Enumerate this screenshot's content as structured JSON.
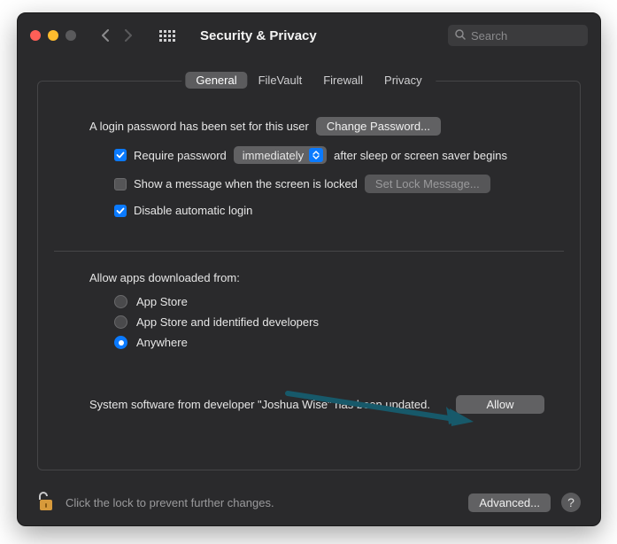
{
  "window": {
    "title": "Security & Privacy",
    "search_placeholder": "Search"
  },
  "tabs": {
    "general": "General",
    "filevault": "FileVault",
    "firewall": "Firewall",
    "privacy": "Privacy"
  },
  "login": {
    "password_set_msg": "A login password has been set for this user",
    "change_password_btn": "Change Password...",
    "require_password_label_pre": "Require password",
    "require_password_selected": "immediately",
    "require_password_label_post": "after sleep or screen saver begins",
    "show_message_label": "Show a message when the screen is locked",
    "set_lock_msg_btn": "Set Lock Message...",
    "disable_auto_login_label": "Disable automatic login"
  },
  "downloads": {
    "heading": "Allow apps downloaded from:",
    "options": {
      "appstore": "App Store",
      "identified": "App Store and identified developers",
      "anywhere": "Anywhere"
    },
    "selected": "anywhere"
  },
  "system_software": {
    "message": "System software from developer \"Joshua Wise\" has been updated.",
    "allow_btn": "Allow"
  },
  "footer": {
    "lock_hint": "Click the lock to prevent further changes.",
    "advanced_btn": "Advanced...",
    "help_glyph": "?"
  }
}
